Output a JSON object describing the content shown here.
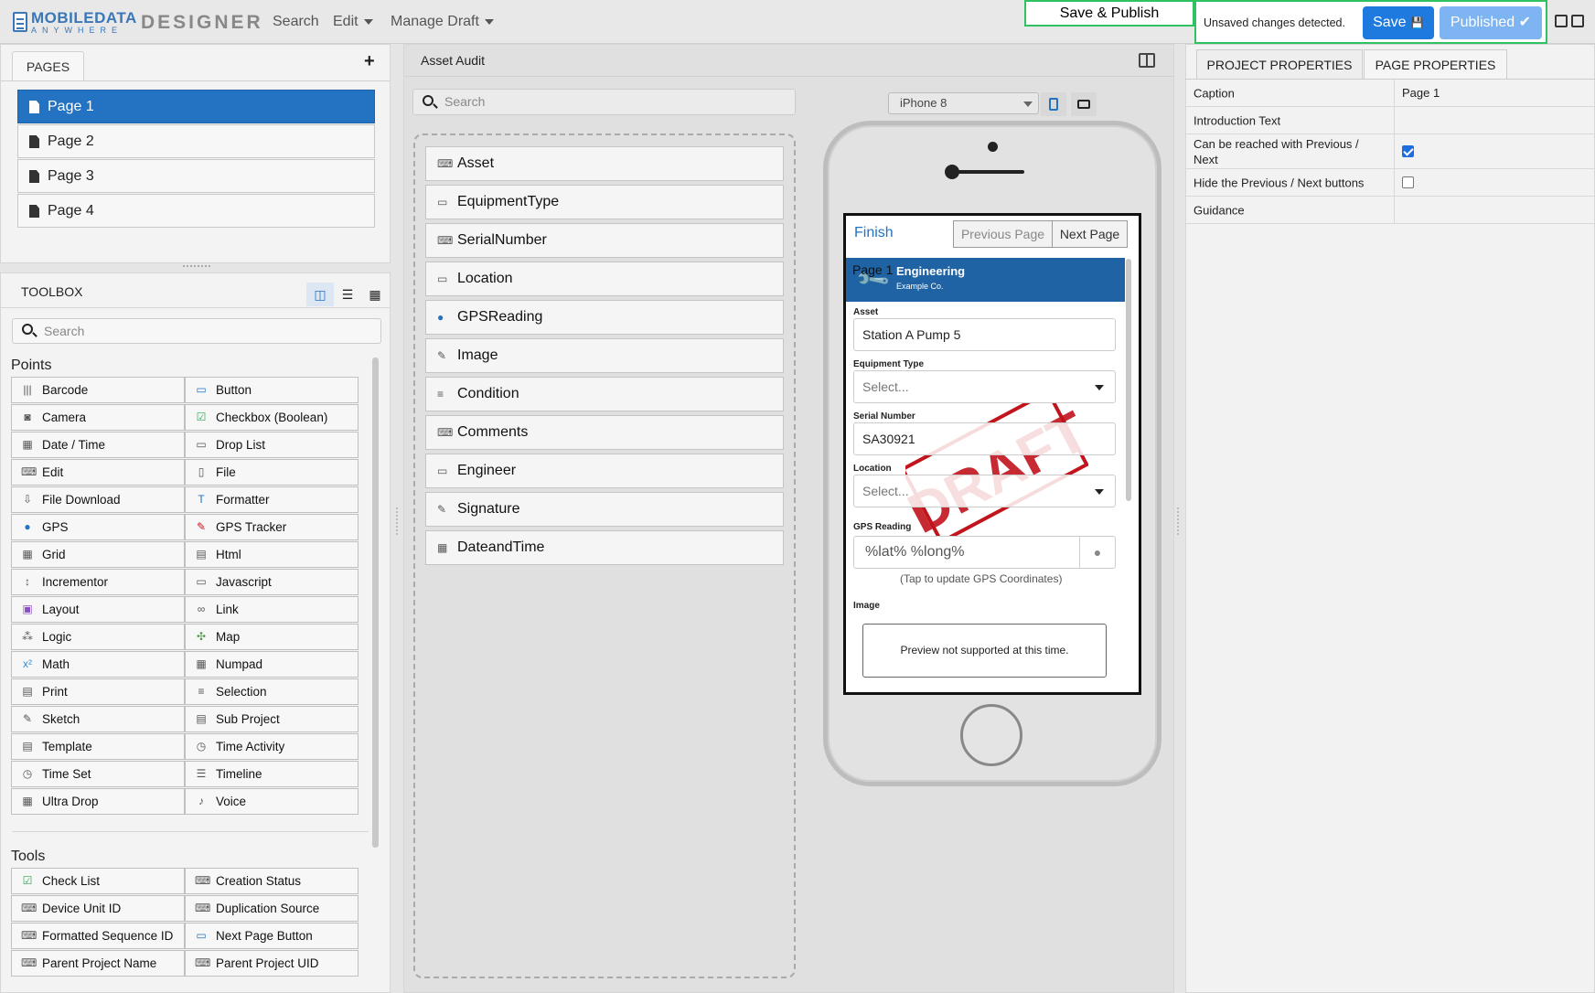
{
  "header": {
    "brand_top": "MOBILEDATA",
    "brand_bottom": "ANYWHERE",
    "app_name": "DESIGNER",
    "nav": [
      "Search",
      "Edit",
      "Manage Draft"
    ],
    "save_publish": "Save & Publish",
    "unsaved": "Unsaved changes detected.",
    "save_button": "Save",
    "published_button": "Published"
  },
  "pages_panel": {
    "tab": "PAGES",
    "pages": [
      "Page 1",
      "Page 2",
      "Page 3",
      "Page 4"
    ],
    "selected": "Page 1"
  },
  "toolbox": {
    "title": "TOOLBOX",
    "search_placeholder": "Search",
    "points_title": "Points",
    "points": [
      {
        "label": "Barcode",
        "icon": "barcode-icon"
      },
      {
        "label": "Button",
        "icon": "button-icon"
      },
      {
        "label": "Camera",
        "icon": "camera-icon"
      },
      {
        "label": "Checkbox (Boolean)",
        "icon": "checkbox-icon"
      },
      {
        "label": "Date / Time",
        "icon": "calendar-icon"
      },
      {
        "label": "Drop List",
        "icon": "droplist-icon"
      },
      {
        "label": "Edit",
        "icon": "edit-icon"
      },
      {
        "label": "File",
        "icon": "file-icon"
      },
      {
        "label": "File Download",
        "icon": "file-download-icon"
      },
      {
        "label": "Formatter",
        "icon": "formatter-icon"
      },
      {
        "label": "GPS",
        "icon": "map-pin-icon"
      },
      {
        "label": "GPS Tracker",
        "icon": "gps-tracker-icon"
      },
      {
        "label": "Grid",
        "icon": "grid-icon"
      },
      {
        "label": "Html",
        "icon": "html-icon"
      },
      {
        "label": "Incrementor",
        "icon": "incrementor-icon"
      },
      {
        "label": "Javascript",
        "icon": "javascript-icon"
      },
      {
        "label": "Layout",
        "icon": "layout-icon"
      },
      {
        "label": "Link",
        "icon": "link-icon"
      },
      {
        "label": "Logic",
        "icon": "logic-icon"
      },
      {
        "label": "Map",
        "icon": "map-icon"
      },
      {
        "label": "Math",
        "icon": "math-icon"
      },
      {
        "label": "Numpad",
        "icon": "numpad-icon"
      },
      {
        "label": "Print",
        "icon": "print-icon"
      },
      {
        "label": "Selection",
        "icon": "selection-icon"
      },
      {
        "label": "Sketch",
        "icon": "sketch-icon"
      },
      {
        "label": "Sub Project",
        "icon": "sub-project-icon"
      },
      {
        "label": "Template",
        "icon": "template-icon"
      },
      {
        "label": "Time Activity",
        "icon": "time-activity-icon"
      },
      {
        "label": "Time Set",
        "icon": "clock-icon"
      },
      {
        "label": "Timeline",
        "icon": "timeline-icon"
      },
      {
        "label": "Ultra Drop",
        "icon": "ultra-drop-icon"
      },
      {
        "label": "Voice",
        "icon": "microphone-icon"
      }
    ],
    "tools_title": "Tools",
    "tools": [
      {
        "label": "Check List",
        "icon": "checklist-icon"
      },
      {
        "label": "Creation Status",
        "icon": "edit-icon"
      },
      {
        "label": "Device Unit ID",
        "icon": "edit-icon"
      },
      {
        "label": "Duplication Source",
        "icon": "edit-icon"
      },
      {
        "label": "Formatted Sequence ID",
        "icon": "edit-icon"
      },
      {
        "label": "Next Page Button",
        "icon": "button-icon"
      },
      {
        "label": "Parent Project Name",
        "icon": "edit-icon"
      },
      {
        "label": "Parent Project UID",
        "icon": "edit-icon"
      }
    ]
  },
  "canvas": {
    "title": "Asset Audit",
    "search_placeholder": "Search",
    "fields": [
      {
        "label": "Asset",
        "icon": "edit-icon"
      },
      {
        "label": "EquipmentType",
        "icon": "droplist-icon"
      },
      {
        "label": "SerialNumber",
        "icon": "edit-icon"
      },
      {
        "label": "Location",
        "icon": "droplist-icon"
      },
      {
        "label": "GPSReading",
        "icon": "map-pin-icon"
      },
      {
        "label": "Image",
        "icon": "sketch-icon"
      },
      {
        "label": "Condition",
        "icon": "selection-icon"
      },
      {
        "label": "Comments",
        "icon": "edit-icon"
      },
      {
        "label": "Engineer",
        "icon": "droplist-icon"
      },
      {
        "label": "Signature",
        "icon": "sketch-icon"
      },
      {
        "label": "DateandTime",
        "icon": "calendar-icon"
      }
    ]
  },
  "preview": {
    "device": "iPhone 8",
    "finish": "Finish",
    "previous": "Previous Page",
    "next": "Next Page",
    "page_caption": "Page 1",
    "banner_title": "Engineering",
    "banner_sub": "Example Co.",
    "asset_label": "Asset",
    "asset_value": "Station A Pump 5",
    "equipment_label": "Equipment Type",
    "equipment_value": "Select...",
    "serial_label": "Serial Number",
    "serial_value": "SA30921",
    "location_label": "Location",
    "location_value": "Select...",
    "gps_label": "GPS Reading",
    "gps_value": "%lat% %long%",
    "gps_hint": "(Tap to update GPS Coordinates)",
    "image_label": "Image",
    "image_preview": "Preview not supported at this time.",
    "watermark": "DRAFT"
  },
  "properties": {
    "tabs": [
      "PROJECT PROPERTIES",
      "PAGE PROPERTIES"
    ],
    "rows": [
      {
        "key": "Caption",
        "value": "Page 1"
      },
      {
        "key": "Introduction Text",
        "value": ""
      },
      {
        "key": "Can be reached with Previous / Next",
        "checked": true
      },
      {
        "key": "Hide the Previous / Next buttons",
        "checked": false
      },
      {
        "key": "Guidance",
        "value": ""
      }
    ]
  },
  "colors": {
    "accent": "#2472c2",
    "highlight_border": "#2fc262",
    "save_button": "#1f7ae0",
    "published_button": "#7fb4f2",
    "banner": "#1f63a5",
    "draft_red": "#c2141c"
  }
}
